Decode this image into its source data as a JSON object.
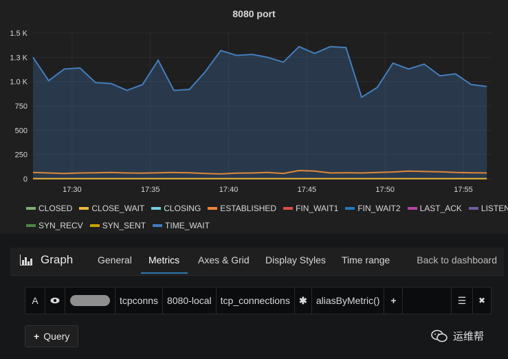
{
  "panel": {
    "title": "8080 port"
  },
  "chart_data": {
    "type": "line",
    "title": "8080 port",
    "ylim": [
      0,
      1500
    ],
    "y_ticks": [
      "0",
      "250",
      "500",
      "750",
      "1.0 K",
      "1.3 K",
      "1.5 K"
    ],
    "y_tick_values": [
      0,
      250,
      500,
      750,
      1000,
      1250,
      1500
    ],
    "x_ticks": [
      "17:30",
      "17:35",
      "17:40",
      "17:45",
      "17:50",
      "17:55"
    ],
    "x_tick_values": [
      30,
      35,
      40,
      45,
      50,
      55
    ],
    "xlim": [
      27.5,
      56.8
    ],
    "x": [
      27.5,
      28.5,
      29.5,
      30.5,
      31.5,
      32.5,
      33.5,
      34.5,
      35.5,
      36.5,
      37.5,
      38.5,
      39.5,
      40.5,
      41.5,
      42.5,
      43.5,
      44.5,
      45.5,
      46.5,
      47.5,
      48.5,
      49.5,
      50.5,
      51.5,
      52.5,
      53.5,
      54.5,
      55.5,
      56.5
    ],
    "series": [
      {
        "name": "TIME_WAIT",
        "color": "#447ebc",
        "fill": true,
        "values": [
          1250,
          1010,
          1130,
          1140,
          990,
          980,
          910,
          970,
          1220,
          910,
          920,
          1100,
          1320,
          1270,
          1280,
          1250,
          1200,
          1360,
          1290,
          1360,
          1350,
          840,
          940,
          1190,
          1130,
          1180,
          1060,
          1080,
          970,
          950
        ]
      },
      {
        "name": "ESTABLISHED",
        "color": "#e2873b",
        "fill": false,
        "values": [
          65,
          60,
          55,
          60,
          62,
          65,
          60,
          58,
          62,
          65,
          62,
          55,
          50,
          58,
          60,
          65,
          55,
          85,
          80,
          60,
          62,
          60,
          65,
          70,
          80,
          75,
          72,
          65,
          62,
          60
        ]
      },
      {
        "name": "CLOSE_WAIT",
        "color": "#eab839",
        "fill": false,
        "values": [
          2,
          2,
          2,
          2,
          2,
          2,
          2,
          2,
          2,
          2,
          2,
          2,
          2,
          2,
          2,
          2,
          2,
          2,
          2,
          2,
          2,
          2,
          2,
          2,
          2,
          2,
          2,
          2,
          2,
          2
        ]
      }
    ],
    "legend": [
      {
        "name": "CLOSED",
        "color": "#7eb26d"
      },
      {
        "name": "CLOSE_WAIT",
        "color": "#eab839"
      },
      {
        "name": "CLOSING",
        "color": "#6ed0e0"
      },
      {
        "name": "ESTABLISHED",
        "color": "#ef843c"
      },
      {
        "name": "FIN_WAIT1",
        "color": "#e24d42"
      },
      {
        "name": "FIN_WAIT2",
        "color": "#1f78c1"
      },
      {
        "name": "LAST_ACK",
        "color": "#ba43a9"
      },
      {
        "name": "LISTEN",
        "color": "#705da0"
      },
      {
        "name": "SYN_RECV",
        "color": "#508642"
      },
      {
        "name": "SYN_SENT",
        "color": "#cca300"
      },
      {
        "name": "TIME_WAIT",
        "color": "#447ebc"
      }
    ],
    "grid": true,
    "legend_placement": "bottom"
  },
  "editor": {
    "title": "Graph",
    "tabs": [
      "General",
      "Metrics",
      "Axes & Grid",
      "Display Styles",
      "Time range"
    ],
    "active_tab": "Metrics",
    "back_label": "Back to dashboard"
  },
  "query": {
    "ref_id": "A",
    "eye_icon": "eye-icon",
    "segments": [
      "tcpconns",
      "8080-local",
      "tcp_connections"
    ],
    "wildcard": "✱",
    "function": "aliasByMetric()",
    "plus": "+",
    "menu": "☰",
    "close": "✖"
  },
  "add_query": {
    "plus": "+",
    "label": "Query"
  },
  "watermark": {
    "text": "运维帮"
  }
}
